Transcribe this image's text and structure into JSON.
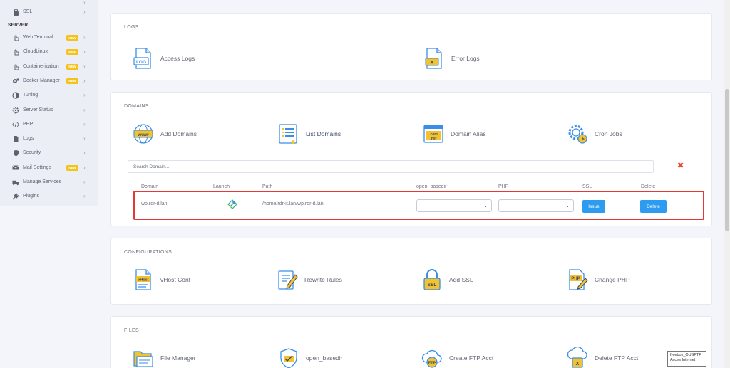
{
  "sidebar": {
    "items_top": [
      {
        "label": "SSL",
        "icon": "lock-icon"
      }
    ],
    "section_label": "SERVER",
    "items": [
      {
        "label": "Web Terminal",
        "badge": "NEW",
        "icon": "hand-pointer-icon"
      },
      {
        "label": "CloudLinux",
        "badge": "NEW",
        "icon": "hand-pointer-icon"
      },
      {
        "label": "Containerization",
        "badge": "NEW",
        "icon": "hand-pointer-icon"
      },
      {
        "label": "Docker Manager",
        "badge": "NEW",
        "icon": "cogs-icon"
      },
      {
        "label": "Tuning",
        "icon": "contrast-icon"
      },
      {
        "label": "Server Status",
        "icon": "gear-icon"
      },
      {
        "label": "PHP",
        "icon": "code-icon"
      },
      {
        "label": "Logs",
        "icon": "file-icon"
      },
      {
        "label": "Security",
        "icon": "shield-icon"
      },
      {
        "label": "Mail Settings",
        "badge": "NEW",
        "icon": "envelope-icon"
      },
      {
        "label": "Manage Services",
        "icon": "truck-icon"
      },
      {
        "label": "Plugins",
        "icon": "plug-icon"
      }
    ]
  },
  "logs_card": {
    "title": "LOGS",
    "tiles": [
      {
        "label": "Access Logs",
        "icon": "log-file-icon",
        "icon_text": "LOG"
      },
      {
        "label": "Error Logs",
        "icon": "error-log-icon",
        "icon_text": "X"
      }
    ]
  },
  "domains_card": {
    "title": "DOMAINS",
    "tiles": [
      {
        "label": "Add Domains",
        "icon": "www-globe-icon",
        "icon_text": "www"
      },
      {
        "label": "List Domains",
        "icon": "list-icon"
      },
      {
        "label": "Domain Alias",
        "icon": "com-net-icon",
        "icon_text": ".com .net"
      },
      {
        "label": "Cron Jobs",
        "icon": "cog-clock-icon"
      }
    ],
    "search_placeholder": "Search Domain...",
    "close_symbol": "✖",
    "table": {
      "headers": [
        "Domain",
        "Launch",
        "Path",
        "open_basedir",
        "PHP",
        "SSL",
        "Delete"
      ],
      "rows": [
        {
          "domain": "wp.rdr-it.lan",
          "path": "/home/rdr-it.lan/wp.rdr-it.lan",
          "open_basedir": "",
          "php": "",
          "ssl_button": "Issue",
          "delete_button": "Delete"
        }
      ]
    }
  },
  "configurations_card": {
    "title": "CONFIGURATIONS",
    "tiles": [
      {
        "label": "vHost Conf",
        "icon": "vhost-file-icon",
        "icon_text": "vHost"
      },
      {
        "label": "Rewrite Rules",
        "icon": "edit-document-icon"
      },
      {
        "label": "Add SSL",
        "icon": "ssl-lock-icon",
        "icon_text": "SSL"
      },
      {
        "label": "Change PHP",
        "icon": "php-file-icon",
        "icon_text": "PHP"
      }
    ]
  },
  "files_card": {
    "title": "FILES",
    "tiles": [
      {
        "label": "File Manager",
        "icon": "folder-icon"
      },
      {
        "label": "open_basedir",
        "icon": "shield-check-icon"
      },
      {
        "label": "Create FTP Acct",
        "icon": "ftp-cloud-icon",
        "icon_text": "FTP"
      },
      {
        "label": "Delete FTP Acct",
        "icon": "ftp-delete-icon",
        "icon_text": "X"
      }
    ]
  },
  "tooltip": {
    "line1": "freebox_OUSPTP",
    "line2": "Acces Internet"
  },
  "colors": {
    "accent_blue": "#2d9cf0",
    "badge_yellow": "#f5c21a",
    "highlight_red": "#e53935",
    "icon_blue": "#3a8ee6",
    "icon_yellow": "#f2c230"
  }
}
